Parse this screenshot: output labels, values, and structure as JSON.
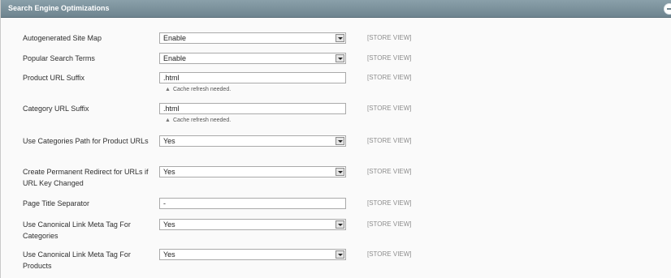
{
  "section": {
    "title": "Search Engine Optimizations"
  },
  "scope_label": "[STORE VIEW]",
  "rows": [
    {
      "label": "Autogenerated Site Map",
      "value": "Enable",
      "type": "select"
    },
    {
      "label": "Popular Search Terms",
      "value": "Enable",
      "type": "select"
    },
    {
      "label": "Product URL Suffix",
      "value": ".html",
      "type": "text",
      "note": "Cache refresh needed."
    },
    {
      "label": "Category URL Suffix",
      "value": ".html",
      "type": "text",
      "note": "Cache refresh needed."
    },
    {
      "label": "Use Categories Path for Product URLs",
      "value": "Yes",
      "type": "select"
    },
    {
      "label": "Create Permanent Redirect for URLs if URL Key Changed",
      "value": "Yes",
      "type": "select"
    },
    {
      "label": "Page Title Separator",
      "value": "-",
      "type": "text"
    },
    {
      "label": "Use Canonical Link Meta Tag For Categories",
      "value": "Yes",
      "type": "select"
    },
    {
      "label": "Use Canonical Link Meta Tag For Products",
      "value": "Yes",
      "type": "select"
    }
  ],
  "icons": {
    "collapse": "collapse-icon",
    "select_arrow": "dropdown-arrow-icon",
    "warning": "warning-icon"
  }
}
